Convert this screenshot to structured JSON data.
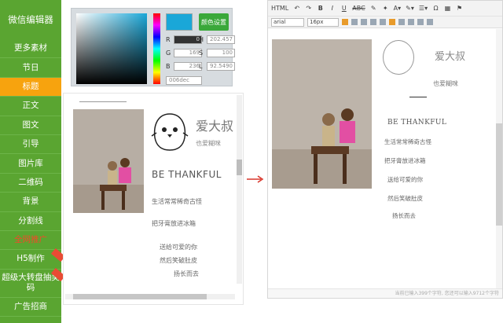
{
  "sidebar": {
    "logo": "微信编辑器",
    "items": [
      {
        "label": "更多素材"
      },
      {
        "label": "节日"
      },
      {
        "label": "标题"
      },
      {
        "label": "正文"
      },
      {
        "label": "图文"
      },
      {
        "label": "引导"
      },
      {
        "label": "图片库"
      },
      {
        "label": "二维码"
      },
      {
        "label": "背景"
      },
      {
        "label": "分割线"
      },
      {
        "label": "全网推广"
      },
      {
        "label": "H5制作"
      },
      {
        "label": "超级大转盘抽奖码"
      },
      {
        "label": "广告招商"
      }
    ],
    "active_index": 2,
    "colors": {
      "bg": "#5aa531",
      "active": "#f7a30e",
      "hot_text": "#f04a2a"
    }
  },
  "color_picker": {
    "set_button": "颜色设置",
    "current_color": "#1aa7d8",
    "fields": {
      "R": "0",
      "G": "169",
      "B": "236",
      "H": "202.457",
      "S": "100",
      "L": "92.5490"
    },
    "hex": "006dec"
  },
  "left_editor": {
    "name": "爱大叔",
    "tagline": "也爱糊咪",
    "thank": "BE THANKFUL",
    "poem": [
      "生活常常稀奇古怪",
      "把牙膏放进冰箱",
      "送给可爱的你",
      "然后笑破肚皮",
      "扬长而去"
    ]
  },
  "right_editor": {
    "toolbar_row1": [
      "HTML",
      "↶",
      "↷",
      "B",
      "I",
      "U",
      "ABC",
      "✎",
      "✦",
      "A▾",
      "✎▾",
      "☰▾",
      "Ω",
      "▦",
      "⚑"
    ],
    "font_select": "arial",
    "size_select": "16px",
    "name": "爱大叔",
    "tagline": "也爱糊咪",
    "thank": "BE THANKFUL",
    "poem": [
      "生活常常稀奇古怪",
      "把牙膏放进冰箱",
      "送给可爱的你",
      "然后笑破肚皮",
      "扬长而去"
    ],
    "footer": "当前已输入399个字符, 您还可以输入9712个字符"
  }
}
